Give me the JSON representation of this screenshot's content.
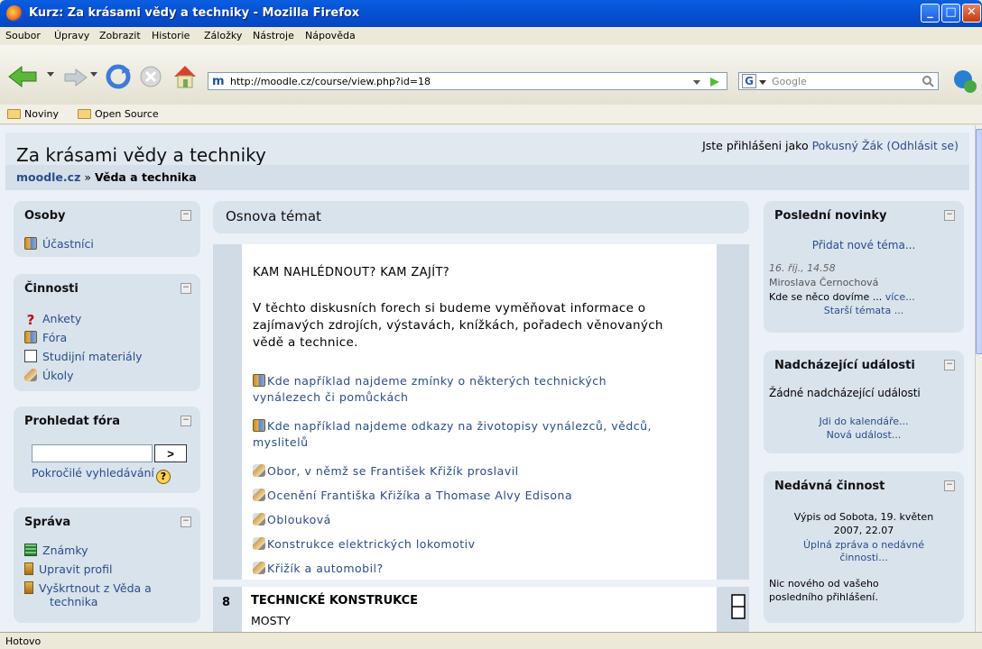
{
  "window": {
    "title": "Kurz: Za krásami vědy a techniky - Mozilla Firefox"
  },
  "menu": [
    "Soubor",
    "Úpravy",
    "Zobrazit",
    "Historie",
    "Záložky",
    "Nástroje",
    "Nápověda"
  ],
  "nav": {
    "url": "http://moodle.cz/course/view.php?id=18",
    "search_placeholder": "Google"
  },
  "bookmarks": [
    "Noviny",
    "Open Source"
  ],
  "page": {
    "title": "Za krásami vědy a techniky",
    "login_prefix": "Jste přihlášeni jako ",
    "user": "Pokusný Žák",
    "logout": "(Odhlásit se)",
    "breadcrumb_home": "moodle.cz",
    "breadcrumb_sep": "»",
    "breadcrumb_current": "Věda a technika"
  },
  "left": {
    "people": {
      "title": "Osoby",
      "items": [
        "Účastníci"
      ]
    },
    "activities": {
      "title": "Činnosti",
      "items": [
        "Ankety",
        "Fóra",
        "Studijní materiály",
        "Úkoly"
      ]
    },
    "search": {
      "title": "Prohledat fóra",
      "go": ">",
      "advanced": "Pokročilé vyhledávání"
    },
    "admin": {
      "title": "Správa",
      "items": [
        "Známky",
        "Upravit profil",
        "Vyškrtnout z Věda a",
        "technika"
      ]
    }
  },
  "center": {
    "heading": "Osnova témat",
    "section0": {
      "title": "KAM NAHLÉDNOUT? KAM ZAJÍT?",
      "intro": [
        "V těchto diskusních forech si budeme vyměňovat informace o",
        "zajímavých zdrojích, výstavách, knížkách, pořadech věnovaných",
        "vědě a technice."
      ],
      "items": [
        {
          "icon": "forum-icon",
          "lines": [
            "Kde například najdeme zmínky o některých technických",
            "vynálezech či pomůckách"
          ]
        },
        {
          "icon": "forum-icon",
          "lines": [
            "Kde například najdeme odkazy na životopisy vynálezců, vědců,",
            "myslitelů"
          ]
        },
        {
          "icon": "assignment-icon",
          "lines": [
            "Obor, v němž se František Křižík proslavil"
          ]
        },
        {
          "icon": "assignment-icon",
          "lines": [
            "Ocenění Františka Křižíka a Thomase Alvy Edisona"
          ]
        },
        {
          "icon": "assignment-icon",
          "lines": [
            "Oblouková"
          ]
        },
        {
          "icon": "assignment-icon",
          "lines": [
            "Konstrukce elektrických lokomotiv"
          ]
        },
        {
          "icon": "assignment-icon",
          "lines": [
            "Křižík a automobil?"
          ]
        }
      ]
    },
    "section8": {
      "number": "8",
      "title": "TECHNICKÉ KONSTRUKCE",
      "sub": "MOSTY"
    }
  },
  "right": {
    "news": {
      "title": "Poslední novinky",
      "add": "Přidat nové téma...",
      "date": "16. říj., 14.58",
      "author": "Miroslava Černochová",
      "text": "Kde se něco dovíme ... ",
      "more": "více...",
      "older": "Starší témata ..."
    },
    "events": {
      "title": "Nadcházející události",
      "none": "Žádné nadcházející události",
      "calendar": "Jdi do kalendáře...",
      "new": "Nová událost..."
    },
    "recent": {
      "title": "Nedávná činnost",
      "since1": "Výpis od Sobota, 19. květen",
      "since2": "2007, 22.07",
      "report1": "Úplná zpráva o nedávné",
      "report2": "činnosti...",
      "nothing1": "Nic nového od vašeho",
      "nothing2": "posledního přihlášení."
    }
  },
  "status": {
    "text": "Hotovo"
  }
}
